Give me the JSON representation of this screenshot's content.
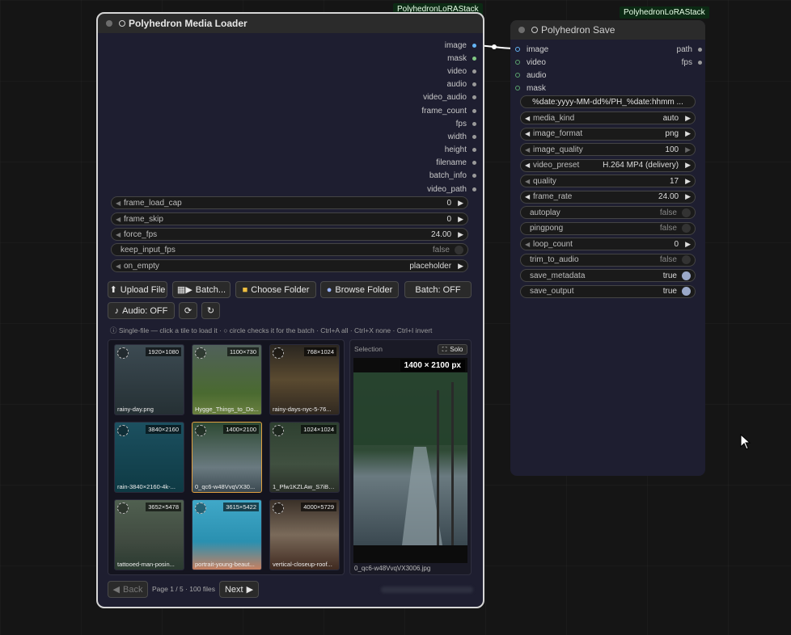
{
  "tags": {
    "left": "PolyhedronLoRAStack",
    "right": "PolyhedronLoRAStack"
  },
  "loader": {
    "title": "Polyhedron Media Loader",
    "outputs": [
      "image",
      "mask",
      "video",
      "audio",
      "video_audio",
      "frame_count",
      "fps",
      "width",
      "height",
      "filename",
      "batch_info",
      "video_path"
    ],
    "widgets": [
      {
        "label": "frame_load_cap",
        "value": "0"
      },
      {
        "label": "frame_skip",
        "value": "0"
      },
      {
        "label": "force_fps",
        "value": "24.00"
      },
      {
        "label": "keep_input_fps",
        "value": "false"
      },
      {
        "label": "on_empty",
        "value": "placeholder"
      }
    ],
    "buttons": {
      "upload": "Upload File",
      "batch": "Batch...",
      "choose_folder": "Choose Folder",
      "browse_folder": "Browse Folder",
      "batch_toggle": "Batch: OFF",
      "audio": "Audio: OFF"
    },
    "hint": "ⓘ Single-file — click a tile to load it · ○ circle checks it for the batch · Ctrl+A all · Ctrl+X none · Ctrl+I invert",
    "tiles": [
      {
        "dims": "1920×1080",
        "name": "rainy-day.png"
      },
      {
        "dims": "1100×730",
        "name": "Hygge_Things_to_Do..."
      },
      {
        "dims": "768×1024",
        "name": "rainy-days-nyc-5-76..."
      },
      {
        "dims": "3840×2160",
        "name": "rain-3840×2160-4k-..."
      },
      {
        "dims": "1400×2100",
        "name": "0_qc6-w48VvqVX30..."
      },
      {
        "dims": "1024×1024",
        "name": "1_Pfw1KZLAw_S7iB69..."
      },
      {
        "dims": "3652×5478",
        "name": "tattooed-man-posin..."
      },
      {
        "dims": "3615×5422",
        "name": "portrait-young-beaut..."
      },
      {
        "dims": "4000×5729",
        "name": "vertical-closeup-roof..."
      }
    ],
    "preview": {
      "header": "Selection",
      "solo": "Solo",
      "size": "1400 × 2100 px",
      "filename": "0_qc6-w48VvqVX3006.jpg"
    },
    "pager": {
      "back": "Back",
      "info": "Page 1 / 5 · 100 files",
      "next": "Next"
    }
  },
  "saver": {
    "title": "Polyhedron Save",
    "inputs": [
      "image",
      "video",
      "audio",
      "mask"
    ],
    "outputs": [
      "path",
      "fps"
    ],
    "filename_pattern": "%date:yyyy-MM-dd%/PH_%date:hhmm ...",
    "widgets": [
      {
        "label": "media_kind",
        "value": "auto",
        "kind": "combo"
      },
      {
        "label": "image_format",
        "value": "png",
        "kind": "combo"
      },
      {
        "label": "image_quality",
        "value": "100",
        "kind": "num"
      },
      {
        "label": "video_preset",
        "value": "H.264 MP4 (delivery)",
        "kind": "combo"
      },
      {
        "label": "quality",
        "value": "17",
        "kind": "num"
      },
      {
        "label": "frame_rate",
        "value": "24.00",
        "kind": "num"
      },
      {
        "label": "autoplay",
        "value": "false",
        "kind": "toggle"
      },
      {
        "label": "pingpong",
        "value": "false",
        "kind": "toggle"
      },
      {
        "label": "loop_count",
        "value": "0",
        "kind": "num"
      },
      {
        "label": "trim_to_audio",
        "value": "false",
        "kind": "toggle"
      },
      {
        "label": "save_metadata",
        "value": "true",
        "kind": "toggle"
      },
      {
        "label": "save_output",
        "value": "true",
        "kind": "toggle"
      }
    ]
  }
}
